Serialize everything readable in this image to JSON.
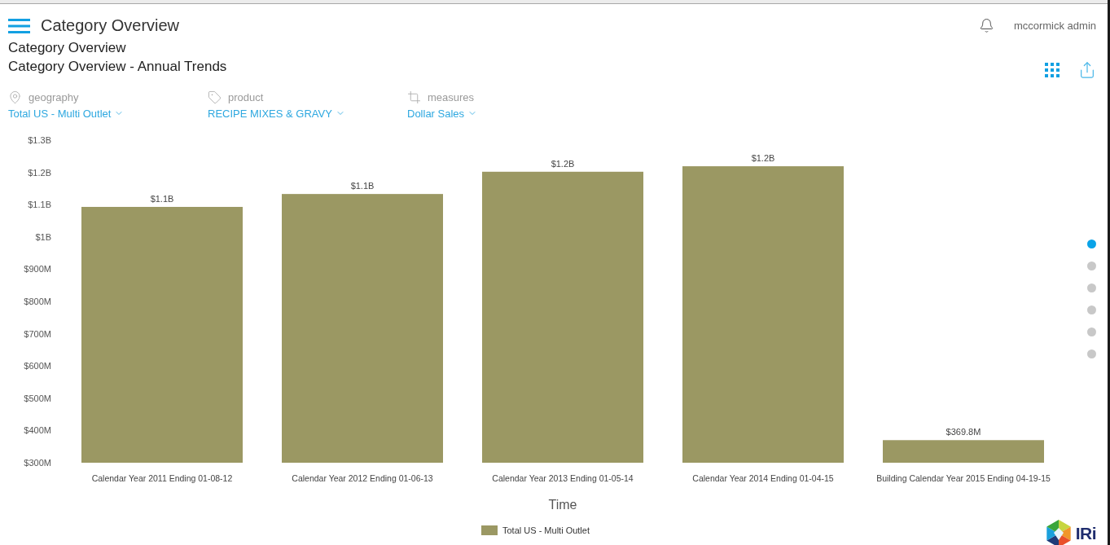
{
  "header": {
    "title": "Category Overview",
    "user": "mccormick admin"
  },
  "page": {
    "title": "Category Overview",
    "subtitle": "Category Overview - Annual Trends"
  },
  "filters": [
    {
      "kind": "geography",
      "label": "geography",
      "value": "Total US - Multi Outlet"
    },
    {
      "kind": "product",
      "label": "product",
      "value": "RECIPE MIXES & GRAVY"
    },
    {
      "kind": "measures",
      "label": "measures",
      "value": "Dollar Sales"
    }
  ],
  "chart": {
    "chart_data": {
      "type": "bar",
      "xlabel": "Time",
      "categories": [
        "Calendar Year 2011 Ending 01-08-12",
        "Calendar Year 2012 Ending 01-06-13",
        "Calendar Year 2013 Ending 01-05-14",
        "Calendar Year 2014 Ending 01-04-15",
        "Building Calendar Year 2015 Ending 04-19-15"
      ],
      "series": [
        {
          "name": "Total US - Multi Outlet",
          "color": "#9b9863",
          "values": [
            1093000000,
            1133000000,
            1202000000,
            1219000000,
            370000000
          ]
        }
      ],
      "ylim": [
        300000000,
        1300000000
      ],
      "yticks": [
        {
          "value": 300000000,
          "label": "$300M"
        },
        {
          "value": 400000000,
          "label": "$400M"
        },
        {
          "value": 500000000,
          "label": "$500M"
        },
        {
          "value": 600000000,
          "label": "$600M"
        },
        {
          "value": 700000000,
          "label": "$700M"
        },
        {
          "value": 800000000,
          "label": "$800M"
        },
        {
          "value": 900000000,
          "label": "$900M"
        },
        {
          "value": 1000000000,
          "label": "$1B"
        },
        {
          "value": 1100000000,
          "label": "$1.1B"
        },
        {
          "value": 1200000000,
          "label": "$1.2B"
        },
        {
          "value": 1300000000,
          "label": "$1.3B"
        }
      ],
      "value_labels": [
        "$1.1B",
        "$1.1B",
        "$1.2B",
        "$1.2B",
        "$369.8M"
      ]
    }
  },
  "pager": [
    {
      "selected": true
    },
    {
      "selected": false
    },
    {
      "selected": false
    },
    {
      "selected": false
    },
    {
      "selected": false
    },
    {
      "selected": false
    }
  ],
  "brand": {
    "name": "IRi"
  }
}
